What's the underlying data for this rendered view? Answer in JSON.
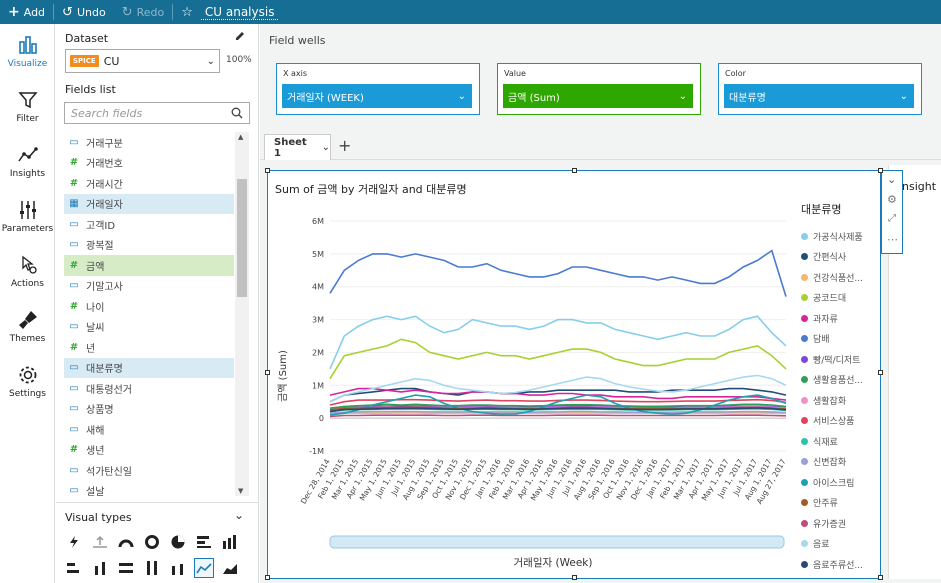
{
  "topbar": {
    "add": "Add",
    "undo": "Undo",
    "redo": "Redo",
    "title": "CU analysis"
  },
  "nav": [
    {
      "label": "Visualize",
      "icon": "bar-chart-icon"
    },
    {
      "label": "Filter",
      "icon": "funnel-icon"
    },
    {
      "label": "Insights",
      "icon": "insights-icon"
    },
    {
      "label": "Parameters",
      "icon": "sliders-icon"
    },
    {
      "label": "Actions",
      "icon": "cursor-gear-icon"
    },
    {
      "label": "Themes",
      "icon": "brush-icon"
    },
    {
      "label": "Settings",
      "icon": "gear-icon"
    }
  ],
  "dataset": {
    "label": "Dataset",
    "badge": "SPICE",
    "name": "CU",
    "percent": "100%"
  },
  "fields_list": {
    "label": "Fields list",
    "placeholder": "Search fields"
  },
  "fields": [
    {
      "name": "거래구분",
      "type": "dim"
    },
    {
      "name": "거래번호",
      "type": "measure"
    },
    {
      "name": "거래시간",
      "type": "measure"
    },
    {
      "name": "거래일자",
      "type": "date",
      "sel": "blue"
    },
    {
      "name": "고객ID",
      "type": "dim"
    },
    {
      "name": "광복절",
      "type": "dim"
    },
    {
      "name": "금액",
      "type": "measure",
      "sel": "green"
    },
    {
      "name": "기말고사",
      "type": "dim"
    },
    {
      "name": "나이",
      "type": "measure"
    },
    {
      "name": "날씨",
      "type": "dim"
    },
    {
      "name": "년",
      "type": "measure"
    },
    {
      "name": "대분류명",
      "type": "dim",
      "sel": "blue"
    },
    {
      "name": "대통령선거",
      "type": "dim"
    },
    {
      "name": "상품명",
      "type": "dim"
    },
    {
      "name": "새해",
      "type": "dim"
    },
    {
      "name": "생년",
      "type": "measure"
    },
    {
      "name": "석가탄신일",
      "type": "dim"
    },
    {
      "name": "설날",
      "type": "dim"
    }
  ],
  "visual_types": {
    "label": "Visual types"
  },
  "field_wells": {
    "title": "Field wells",
    "x": {
      "label": "X axis",
      "value": "거래일자 (WEEK)"
    },
    "value": {
      "label": "Value",
      "value": "금액 (Sum)"
    },
    "color": {
      "label": "Color",
      "value": "대분류명"
    }
  },
  "sheet": {
    "tab": "Sheet 1"
  },
  "next_visual_text": "nsight",
  "colors": {
    "topbar": "#166e94",
    "accent": "#1a7bb9",
    "value_well": "#2ea800"
  },
  "chart_data": {
    "type": "line",
    "title": "Sum of 금액 by 거래일자 and 대분류명",
    "xlabel": "거래일자 (Week)",
    "ylabel": "금액 (Sum)",
    "ylim": [
      -1000000,
      6000000
    ],
    "yticks": [
      "6M",
      "5M",
      "4M",
      "3M",
      "2M",
      "1M",
      "0",
      "-1M"
    ],
    "xticks": [
      "Dec 28, 2014",
      "Feb 1, 2015",
      "Mar 1, 2015",
      "Apr 1, 2015",
      "May 1, 2015",
      "Jun 1, 2015",
      "Jul 1, 2015",
      "Aug 1, 2015",
      "Sep 1, 2015",
      "Oct 1, 2015",
      "Nov 1, 2015",
      "Dec 1, 2015",
      "Jan 1, 2016",
      "Feb 1, 2016",
      "Mar 1, 2016",
      "Apr 1, 2016",
      "May 1, 2016",
      "Jun 1, 2016",
      "Jul 1, 2016",
      "Aug 1, 2016",
      "Sep 1, 2016",
      "Oct 1, 2016",
      "Nov 1, 2016",
      "Dec 1, 2016",
      "Jan 1, 2017",
      "Feb 1, 2017",
      "Mar 1, 2017",
      "Apr 1, 2017",
      "May 1, 2017",
      "Jun 1, 2017",
      "Jul 1, 2017",
      "Aug 1, 2017",
      "Aug 27, 2017"
    ],
    "legend_title": "대분류명",
    "series": [
      {
        "name": "가공식사제품",
        "color": "#87ceeb",
        "values": [
          1500000,
          2500000,
          2800000,
          3000000,
          3100000,
          3000000,
          3100000,
          2800000,
          2600000,
          2700000,
          3000000,
          2900000,
          2800000,
          2800000,
          2700000,
          2800000,
          3000000,
          3000000,
          2900000,
          2900000,
          2700000,
          2600000,
          2500000,
          2400000,
          2500000,
          2600000,
          2500000,
          2500000,
          2700000,
          3000000,
          3100000,
          2600000,
          2200000
        ]
      },
      {
        "name": "간편식사",
        "color": "#1f4e79",
        "values": [
          500000,
          700000,
          750000,
          800000,
          850000,
          900000,
          900000,
          800000,
          750000,
          700000,
          800000,
          800000,
          750000,
          750000,
          800000,
          800000,
          850000,
          850000,
          850000,
          850000,
          850000,
          800000,
          800000,
          800000,
          850000,
          850000,
          850000,
          850000,
          900000,
          900000,
          850000,
          800000,
          700000
        ]
      },
      {
        "name": "건강식품선...",
        "color": "#f0b96b",
        "values": [
          100000,
          150000,
          150000,
          150000,
          150000,
          160000,
          160000,
          150000,
          150000,
          150000,
          160000,
          160000,
          150000,
          150000,
          150000,
          150000,
          160000,
          160000,
          160000,
          160000,
          150000,
          150000,
          150000,
          150000,
          150000,
          150000,
          150000,
          150000,
          160000,
          160000,
          160000,
          150000,
          140000
        ]
      },
      {
        "name": "공코드대",
        "color": "#a7d130",
        "values": [
          1200000,
          1900000,
          2000000,
          2100000,
          2200000,
          2400000,
          2300000,
          2000000,
          1900000,
          1800000,
          1900000,
          2000000,
          1900000,
          1900000,
          1800000,
          1900000,
          2000000,
          2100000,
          2100000,
          2000000,
          1800000,
          1700000,
          1600000,
          1600000,
          1700000,
          1800000,
          1800000,
          1800000,
          2000000,
          2100000,
          2200000,
          1900000,
          1500000
        ]
      },
      {
        "name": "과자류",
        "color": "#d6259b",
        "values": [
          700000,
          800000,
          900000,
          900000,
          850000,
          800000,
          850000,
          800000,
          750000,
          750000,
          800000,
          800000,
          750000,
          750000,
          700000,
          700000,
          750000,
          750000,
          700000,
          700000,
          650000,
          650000,
          650000,
          600000,
          600000,
          650000,
          650000,
          650000,
          650000,
          650000,
          650000,
          600000,
          550000
        ]
      },
      {
        "name": "담배",
        "color": "#4a7bd0",
        "values": [
          3800000,
          4500000,
          4800000,
          5000000,
          5000000,
          4900000,
          5000000,
          4900000,
          4800000,
          4600000,
          4600000,
          4700000,
          4500000,
          4400000,
          4300000,
          4300000,
          4400000,
          4600000,
          4600000,
          4500000,
          4400000,
          4300000,
          4300000,
          4200000,
          4300000,
          4200000,
          4100000,
          4100000,
          4300000,
          4600000,
          4800000,
          5100000,
          3700000
        ]
      },
      {
        "name": "빵/떡/디저트",
        "color": "#7b45e0",
        "values": [
          300000,
          350000,
          350000,
          360000,
          360000,
          370000,
          370000,
          360000,
          350000,
          350000,
          360000,
          360000,
          350000,
          350000,
          350000,
          350000,
          360000,
          360000,
          360000,
          360000,
          350000,
          350000,
          340000,
          340000,
          340000,
          350000,
          350000,
          350000,
          360000,
          360000,
          360000,
          350000,
          320000
        ]
      },
      {
        "name": "생활용품선...",
        "color": "#2f9e5a",
        "values": [
          300000,
          350000,
          380000,
          400000,
          420000,
          400000,
          420000,
          400000,
          380000,
          380000,
          400000,
          400000,
          380000,
          380000,
          370000,
          380000,
          400000,
          410000,
          410000,
          400000,
          380000,
          370000,
          360000,
          360000,
          370000,
          380000,
          380000,
          380000,
          400000,
          420000,
          420000,
          400000,
          350000
        ]
      },
      {
        "name": "생활잡화",
        "color": "#f090c8",
        "values": [
          250000,
          300000,
          320000,
          330000,
          340000,
          330000,
          340000,
          330000,
          320000,
          320000,
          330000,
          330000,
          320000,
          320000,
          310000,
          320000,
          330000,
          330000,
          330000,
          330000,
          320000,
          310000,
          300000,
          300000,
          310000,
          320000,
          320000,
          320000,
          330000,
          340000,
          340000,
          330000,
          300000
        ]
      },
      {
        "name": "서비스상품",
        "color": "#e0445c",
        "values": [
          400000,
          500000,
          550000,
          550000,
          550000,
          560000,
          560000,
          550000,
          530000,
          520000,
          540000,
          550000,
          530000,
          530000,
          520000,
          520000,
          540000,
          550000,
          550000,
          540000,
          520000,
          510000,
          500000,
          500000,
          510000,
          520000,
          520000,
          520000,
          540000,
          550000,
          560000,
          540000,
          480000
        ]
      },
      {
        "name": "식재료",
        "color": "#2cc4a8",
        "values": [
          200000,
          250000,
          260000,
          270000,
          280000,
          280000,
          280000,
          270000,
          260000,
          260000,
          270000,
          270000,
          260000,
          260000,
          250000,
          260000,
          270000,
          270000,
          270000,
          270000,
          260000,
          250000,
          250000,
          250000,
          250000,
          260000,
          260000,
          260000,
          270000,
          280000,
          280000,
          270000,
          240000
        ]
      },
      {
        "name": "신변잡화",
        "color": "#9aa0d8",
        "values": [
          150000,
          180000,
          190000,
          200000,
          200000,
          200000,
          200000,
          190000,
          190000,
          190000,
          190000,
          190000,
          190000,
          190000,
          180000,
          190000,
          190000,
          200000,
          200000,
          190000,
          190000,
          180000,
          180000,
          180000,
          180000,
          190000,
          190000,
          190000,
          190000,
          200000,
          200000,
          190000,
          170000
        ]
      },
      {
        "name": "아이스크림",
        "color": "#1fa0b0",
        "values": [
          100000,
          150000,
          250000,
          400000,
          500000,
          600000,
          700000,
          650000,
          450000,
          300000,
          200000,
          150000,
          120000,
          130000,
          200000,
          350000,
          500000,
          600000,
          700000,
          650000,
          450000,
          300000,
          200000,
          150000,
          120000,
          150000,
          250000,
          400000,
          550000,
          650000,
          700000,
          600000,
          450000
        ]
      },
      {
        "name": "안주류",
        "color": "#a35a2a",
        "values": [
          250000,
          300000,
          310000,
          320000,
          320000,
          330000,
          330000,
          320000,
          310000,
          300000,
          310000,
          320000,
          310000,
          300000,
          300000,
          300000,
          310000,
          320000,
          320000,
          310000,
          300000,
          290000,
          290000,
          290000,
          300000,
          300000,
          300000,
          300000,
          310000,
          320000,
          320000,
          310000,
          280000
        ]
      },
      {
        "name": "유가증권",
        "color": "#c04a7a",
        "values": [
          50000,
          80000,
          80000,
          90000,
          90000,
          90000,
          90000,
          90000,
          80000,
          80000,
          90000,
          90000,
          80000,
          80000,
          80000,
          80000,
          90000,
          90000,
          90000,
          90000,
          80000,
          80000,
          80000,
          80000,
          80000,
          80000,
          80000,
          80000,
          90000,
          90000,
          90000,
          80000,
          70000
        ]
      },
      {
        "name": "음료",
        "color": "#a6d8f0",
        "values": [
          500000,
          700000,
          800000,
          900000,
          1000000,
          1100000,
          1200000,
          1150000,
          1000000,
          900000,
          850000,
          800000,
          750000,
          780000,
          850000,
          950000,
          1050000,
          1150000,
          1250000,
          1200000,
          1050000,
          950000,
          880000,
          820000,
          800000,
          850000,
          950000,
          1050000,
          1150000,
          1250000,
          1300000,
          1200000,
          1000000
        ]
      },
      {
        "name": "음료주류선...",
        "color": "#274a6e",
        "values": [
          200000,
          260000,
          270000,
          280000,
          290000,
          290000,
          300000,
          290000,
          280000,
          270000,
          280000,
          290000,
          280000,
          280000,
          270000,
          280000,
          290000,
          300000,
          300000,
          290000,
          280000,
          270000,
          260000,
          260000,
          270000,
          280000,
          280000,
          280000,
          290000,
          300000,
          310000,
          290000,
          250000
        ]
      }
    ]
  }
}
